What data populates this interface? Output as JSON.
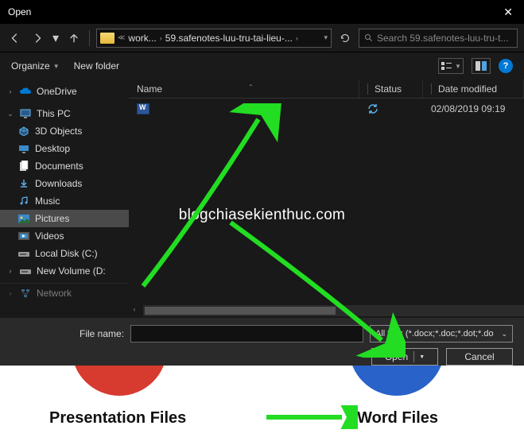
{
  "dialog": {
    "title": "Open",
    "breadcrumb": {
      "root": "work...",
      "current": "59.safenotes-luu-tru-tai-lieu-..."
    },
    "search_placeholder": "Search 59.safenotes-luu-tru-t...",
    "toolbar": {
      "organize": "Organize",
      "newfolder": "New folder"
    },
    "columns": {
      "name": "Name",
      "status": "Status",
      "date": "Date modified"
    },
    "file": {
      "name": "",
      "date": "02/08/2019 09:19"
    },
    "filename_label": "File name:",
    "filter": "All files (*.docx;*.doc;*.dot;*.do",
    "open": "Open",
    "cancel": "Cancel"
  },
  "tree": {
    "onedrive": "OneDrive",
    "thispc": "This PC",
    "items": [
      "3D Objects",
      "Desktop",
      "Documents",
      "Downloads",
      "Music",
      "Pictures",
      "Videos",
      "Local Disk (C:)",
      "New Volume (D:"
    ],
    "network": "Network"
  },
  "watermark": "blogchiasekienthuc.com",
  "bottom": {
    "presentation": "Presentation Files",
    "word": "Word Files"
  }
}
